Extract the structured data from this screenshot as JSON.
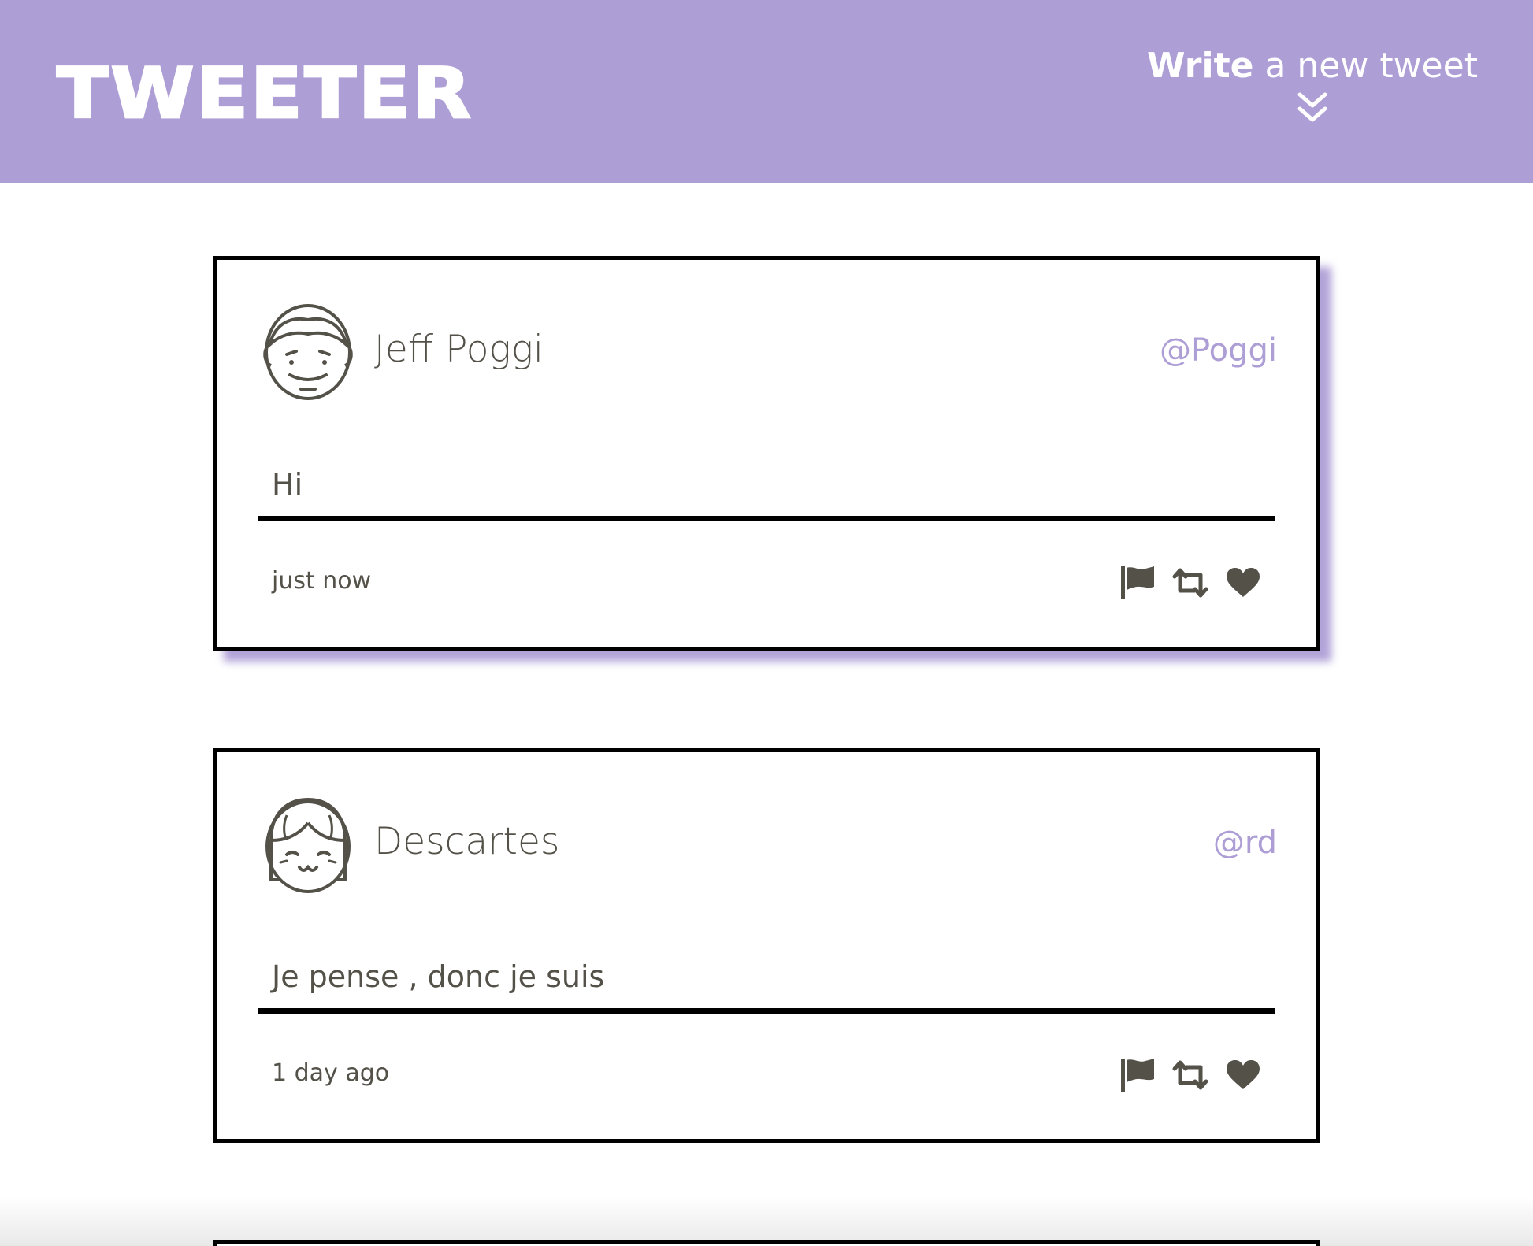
{
  "app": {
    "brand": "TWEETER",
    "compose_bold": "Write",
    "compose_rest": " a new tweet"
  },
  "colors": {
    "accent": "#ae9ed6",
    "text": "#545149",
    "border": "#000000"
  },
  "tweets": [
    {
      "name": "Jeff Poggi",
      "handle": "@Poggi",
      "text": "Hi",
      "time": "just now",
      "avatar_icon": "male-face-avatar-icon"
    },
    {
      "name": "Descartes",
      "handle": "@rd",
      "text": "Je pense , donc je suis",
      "time": "1 day ago",
      "avatar_icon": "female-face-avatar-icon"
    }
  ],
  "actions": [
    "flag-icon",
    "retweet-icon",
    "heart-icon"
  ]
}
